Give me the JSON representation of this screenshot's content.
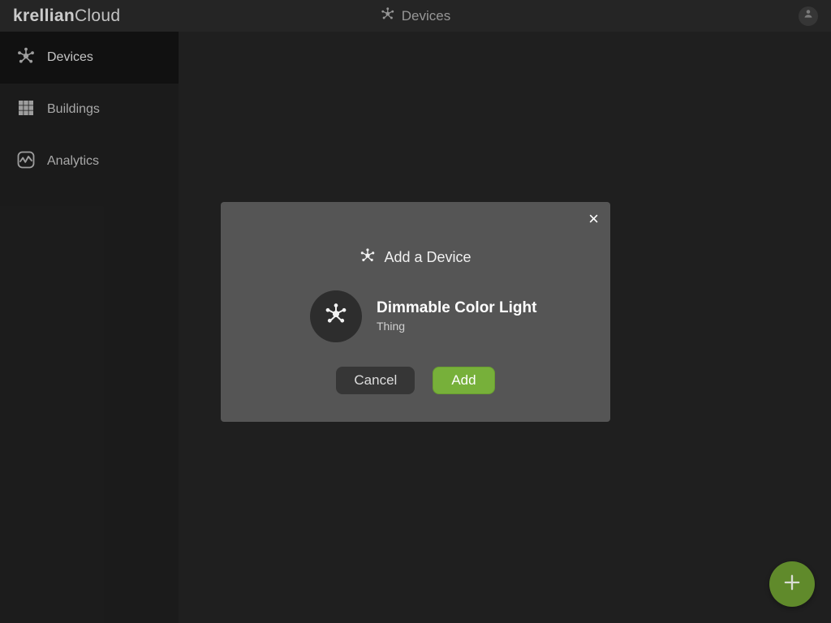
{
  "brand": {
    "bold": "krellian",
    "light": "Cloud"
  },
  "header": {
    "section": "Devices"
  },
  "sidebar": {
    "items": [
      {
        "key": "devices",
        "label": "Devices",
        "icon": "devices-icon",
        "active": true
      },
      {
        "key": "buildings",
        "label": "Buildings",
        "icon": "buildings-icon",
        "active": false
      },
      {
        "key": "analytics",
        "label": "Analytics",
        "icon": "analytics-icon",
        "active": false
      }
    ]
  },
  "fab": {
    "label": "Add",
    "icon": "plus-icon"
  },
  "modal": {
    "title": "Add a Device",
    "close_label": "×",
    "device": {
      "name": "Dimmable Color Light",
      "subtitle": "Thing",
      "icon": "devices-icon"
    },
    "actions": {
      "cancel": "Cancel",
      "add": "Add"
    }
  },
  "colors": {
    "accent": "#77b03a",
    "bg": "#232323",
    "panel": "#555555"
  }
}
